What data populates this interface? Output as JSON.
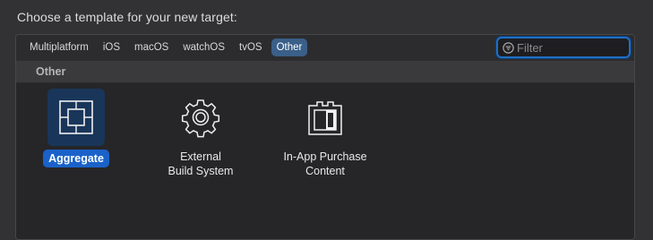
{
  "header": {
    "title": "Choose a template for your new target:"
  },
  "tabs": [
    {
      "label": "Multiplatform"
    },
    {
      "label": "iOS"
    },
    {
      "label": "macOS"
    },
    {
      "label": "watchOS"
    },
    {
      "label": "tvOS"
    },
    {
      "label": "Other",
      "selected": true
    }
  ],
  "filter": {
    "placeholder": "Filter",
    "value": "",
    "icon": "filter-icon"
  },
  "section": {
    "title": "Other"
  },
  "templates": [
    {
      "label_lines": [
        "Aggregate"
      ],
      "icon": "aggregate-icon",
      "selected": true
    },
    {
      "label_lines": [
        "External",
        "Build System"
      ],
      "icon": "gear-icon",
      "selected": false
    },
    {
      "label_lines": [
        "In-App Purchase",
        "Content"
      ],
      "icon": "package-icon",
      "selected": false
    }
  ],
  "colors": {
    "accent": "#1a62c9",
    "selected_tab": "#3a5f88",
    "background": "#323234"
  }
}
